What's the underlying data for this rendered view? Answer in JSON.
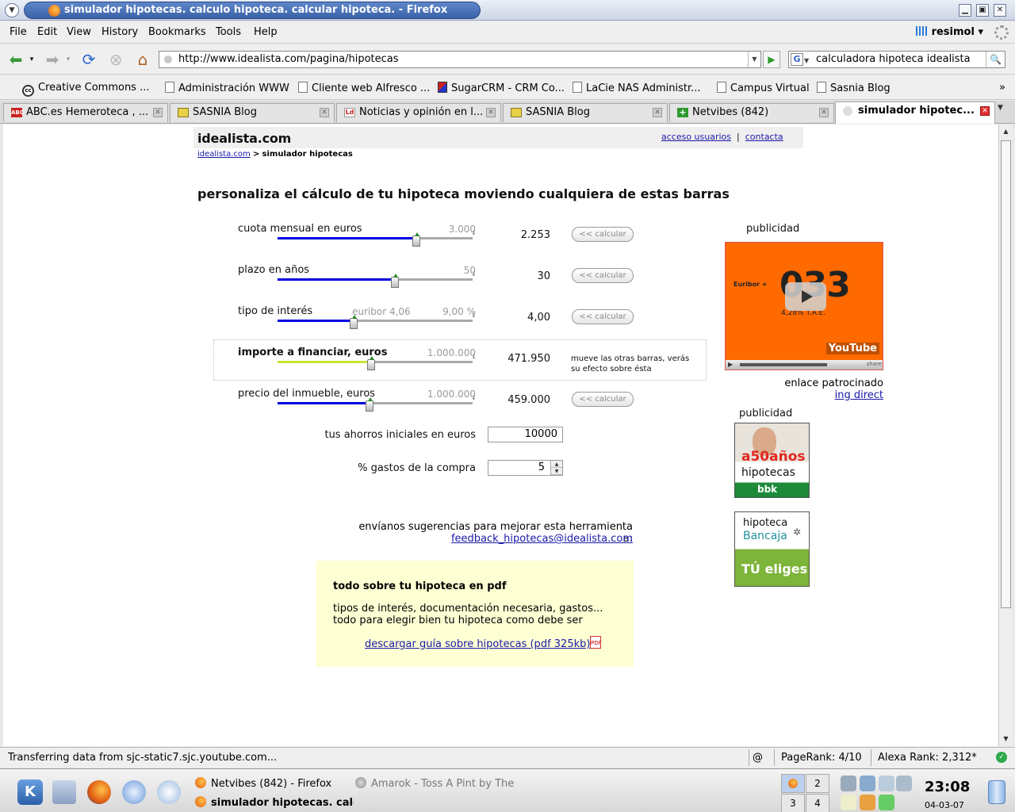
{
  "window": {
    "title": "simulador hipotecas. calculo hipoteca. calcular hipoteca. - Firefox"
  },
  "menu": [
    "File",
    "Edit",
    "View",
    "History",
    "Bookmarks",
    "Tools",
    "Help"
  ],
  "profile": "resimol",
  "nav": {
    "url": "http://www.idealista.com/pagina/hipotecas",
    "search_value": "calculadora hipoteca idealista",
    "search_engine_letter": "G"
  },
  "bookmarks": [
    "Creative Commons ...",
    "Administración WWW",
    "Cliente web Alfresco ...",
    "SugarCRM - CRM Co...",
    "LaCie NAS Administr...",
    "Campus Virtual",
    "Sasnia Blog"
  ],
  "bookmarks_overflow": "»",
  "tabs": [
    "ABC.es Hemeroteca , ...",
    "SASNIA Blog",
    "Noticias y opinión en l...",
    "SASNIA Blog",
    "Netvibes (842)",
    "simulador hipotec..."
  ],
  "page": {
    "logo": "idealista.com",
    "top_links": {
      "access": "acceso usuarios",
      "sep": "|",
      "contact": "contacta"
    },
    "breadcrumb": {
      "home": "idealista.com",
      "sep": ">",
      "current": "simulador hipotecas"
    },
    "heading": "personaliza el cálculo de tu hipoteca moviendo cualquiera de estas barras",
    "calc_label": "<< calcular",
    "sliders": [
      {
        "label": "cuota mensual en euros",
        "max": "3.000",
        "value": "2.253",
        "fraction": 0.71
      },
      {
        "label": "plazo en años",
        "max": "50",
        "value": "30",
        "fraction": 0.6
      },
      {
        "label": "tipo de interés",
        "min": "euribor 4,06",
        "max": "9,00 %",
        "value": "4,00",
        "fraction": 0.39
      },
      {
        "label": "importe a financiar, euros",
        "max": "1.000.000",
        "value": "471.950",
        "fraction": 0.48
      },
      {
        "label": "precio del inmueble, euros",
        "max": "1.000.000",
        "value": "459.000",
        "fraction": 0.47
      }
    ],
    "hint": "mueve las otras barras, verás su efecto sobre ésta",
    "savings": {
      "label": "tus ahorros iniciales en euros",
      "value": "10000"
    },
    "expenses": {
      "label": "% gastos de la compra",
      "value": "5"
    },
    "feedback": {
      "text": "envíanos sugerencias para mejorar esta herramienta a:",
      "email": "feedback_hipotecas@idealista.com"
    },
    "pdf": {
      "title": "todo sobre tu hipoteca en pdf",
      "line1": "tipos de interés, documentación necesaria, gastos...",
      "line2": "todo para elegir bien tu hipoteca como debe ser",
      "link": "descargar guía sobre hipotecas (pdf 325kb)"
    },
    "ads": {
      "label": "publicidad",
      "video": {
        "big": "033",
        "small": "Euribor +",
        "rate": "4,28% T.A.E.",
        "brand": "YouTube",
        "share": "share"
      },
      "sponsor_label": "enlace patrocinado",
      "sponsor_link": "ing direct",
      "bbk": {
        "title": "a50años",
        "sub": "hipotecas",
        "brand": "bbk"
      },
      "bancaja": {
        "top": "hipoteca",
        "brand": "Bancaja",
        "slogan": "TÚ eliges"
      }
    }
  },
  "status": {
    "text": "Transferring data from sjc-static7.sjc.youtube.com...",
    "pagerank": "PageRank: 4/10",
    "alexa": "Alexa Rank: 2,312*"
  },
  "taskbar": {
    "tasks": [
      "Netvibes (842) - Firefox",
      "Amarok - Toss A Pint by The",
      "simulador hipotecas. calc"
    ],
    "pager": [
      "2",
      "3",
      "4"
    ],
    "clock": "23:08",
    "date": "04-03-07"
  }
}
